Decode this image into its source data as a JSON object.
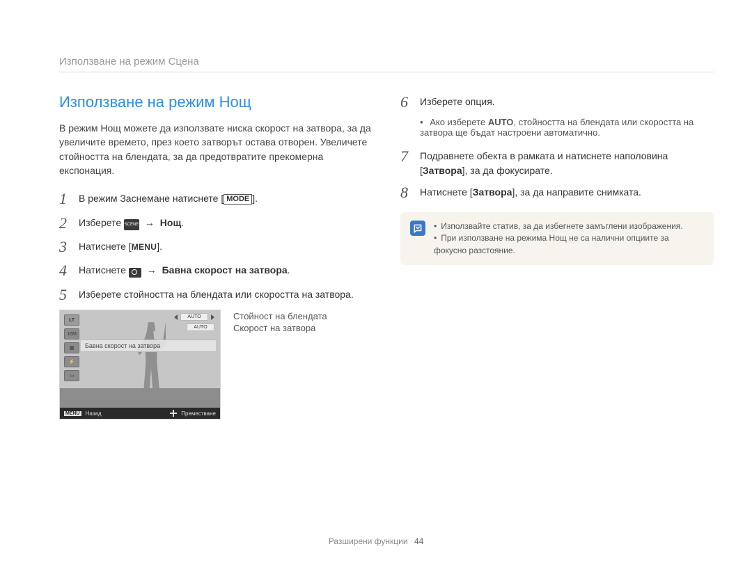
{
  "breadcrumb": "Използване на режим Сцена",
  "section_title": "Използване на режим Нощ",
  "intro": "В режим Нощ можете да използвате ниска скорост на затвора, за да увеличите времето, през което затворът остава отворен. Увеличете стойността на блендата, за да предотвратите прекомерна експонация.",
  "steps_left": {
    "s1": {
      "n": "1",
      "a": "В режим Заснемане натиснете [",
      "b": "MODE",
      "c": "]."
    },
    "s2": {
      "n": "2",
      "a": "Изберете ",
      "scene": "SCENE",
      "arrow": "→",
      "bold": "Нощ",
      "end": "."
    },
    "s3": {
      "n": "3",
      "a": "Натиснете [",
      "b": "MENU",
      "c": "]."
    },
    "s4": {
      "n": "4",
      "a": "Натиснете ",
      "arrow": "→",
      "bold": "Бавна скорост на затвора",
      "end": "."
    },
    "s5": {
      "n": "5",
      "t": "Изберете стойността на блендата или скоростта на затвора."
    }
  },
  "screenshot": {
    "lt": "LT",
    "icon16m": "16M",
    "auto1": "AUTO",
    "auto2": "AUTO",
    "caption": "Бавна скорост на затвора",
    "footer_menu": "MENU",
    "footer_back": "Назад",
    "footer_move": "Преместване"
  },
  "callout_aperture": "Стойност на блендата",
  "callout_shutter": "Скорост на затвора",
  "steps_right": {
    "s6": {
      "n": "6",
      "t": "Изберете опция."
    },
    "s6_note": {
      "a": "Ако изберете ",
      "b": "AUTO",
      "c": ", стойността на блендата или скоростта на затвора ще бъдат настроени автоматично."
    },
    "s7": {
      "n": "7",
      "a": "Подравнете обекта в рамката и натиснете наполовина [",
      "b": "Затвора",
      "c": "], за да фокусирате."
    },
    "s8": {
      "n": "8",
      "a": "Натиснете [",
      "b": "Затвора",
      "c": "], за да направите снимката."
    }
  },
  "info": {
    "tip1": "Използвайте статив, за да избегнете замъглени изображения.",
    "tip2": "При използване на режима Нощ не са налични опциите за фокусно разстояние."
  },
  "footer_label": "Разширени функции",
  "footer_page": "44"
}
